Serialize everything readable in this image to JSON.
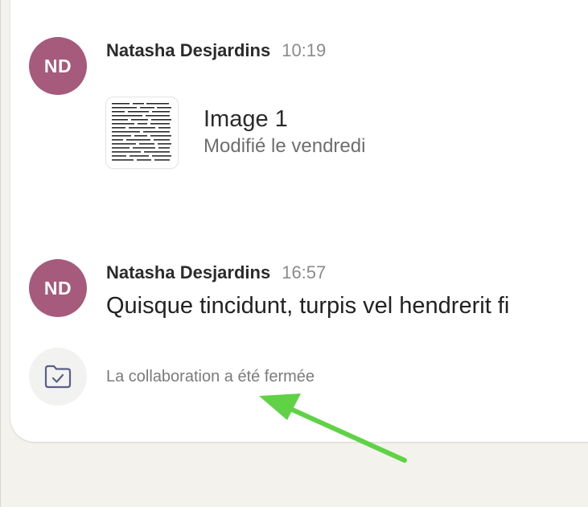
{
  "messages": [
    {
      "avatar_initials": "ND",
      "author": "Natasha Desjardins",
      "time": "10:19",
      "attachment": {
        "name": "Image 1",
        "meta": "Modifié le vendredi",
        "thumbnail_icon": "document-thumbnail"
      }
    },
    {
      "avatar_initials": "ND",
      "author": "Natasha Desjardins",
      "time": "16:57",
      "text": "Quisque tincidunt, turpis vel hendrerit fi"
    }
  ],
  "event": {
    "icon": "folder-check-icon",
    "text": "La collaboration a été fermée"
  },
  "annotation": {
    "color": "#5fd246"
  },
  "colors": {
    "avatar": "#a65a7c",
    "background": "#f3f2ed",
    "card": "#ffffff"
  }
}
